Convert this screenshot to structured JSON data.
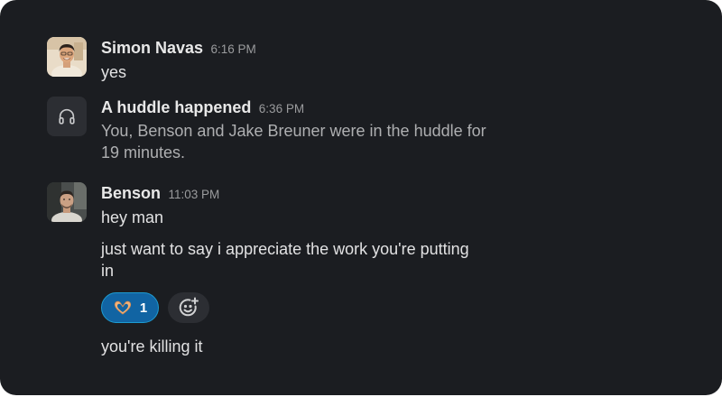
{
  "messages": [
    {
      "author": "Simon Navas",
      "time": "6:16 PM",
      "lines": [
        "yes"
      ],
      "avatar": "simon-avatar"
    },
    {
      "author": "A huddle happened",
      "time": "6:36 PM",
      "text": "You, Benson and Jake Breuner were in the huddle for 19 minutes.",
      "icon": "headphones-icon"
    },
    {
      "author": "Benson",
      "time": "11:03 PM",
      "lines": [
        "hey man",
        "just want to say i appreciate the work you're putting in"
      ],
      "reaction": {
        "emoji": "heart-hands-emoji",
        "count": "1"
      },
      "add_reaction_icon": "add-reaction-icon",
      "followup": "you're killing it",
      "avatar": "benson-avatar"
    }
  ],
  "colors": {
    "background": "#1b1d21",
    "reaction_active_bg": "#1164a3",
    "reaction_active_border": "#1d9bd1"
  }
}
